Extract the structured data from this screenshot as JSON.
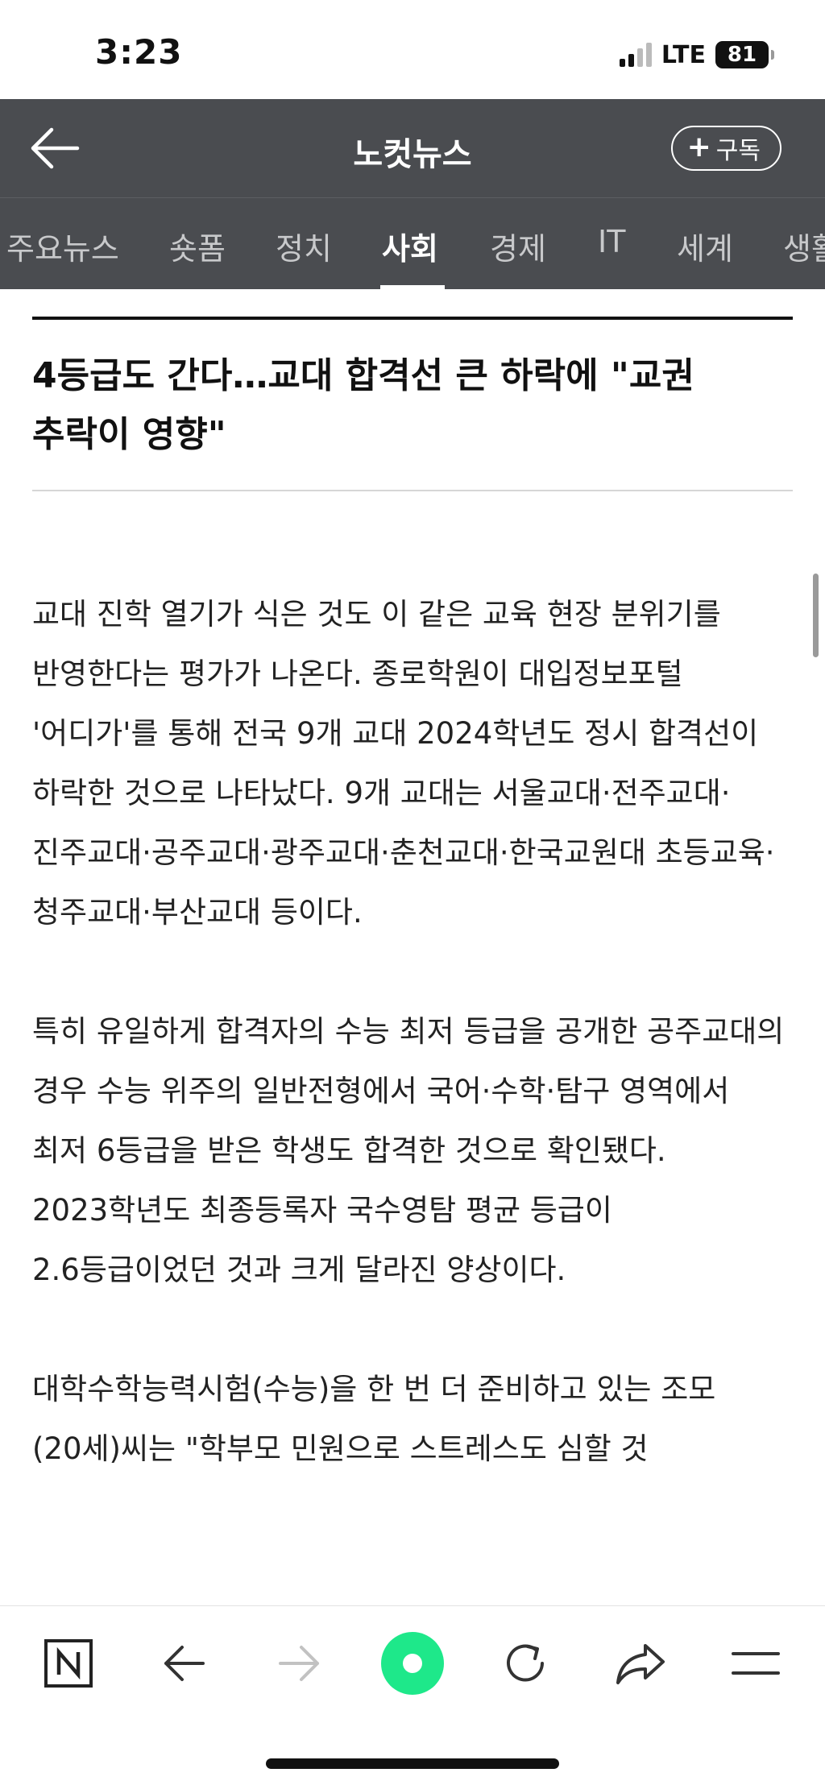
{
  "status_bar": {
    "time": "3:23",
    "network": "LTE",
    "battery": "81"
  },
  "header": {
    "title": "노컷뉴스",
    "subscribe_label": "구독"
  },
  "tabs": [
    {
      "label": "주요뉴스"
    },
    {
      "label": "숏폼"
    },
    {
      "label": "정치"
    },
    {
      "label": "사회",
      "active": true
    },
    {
      "label": "경제"
    },
    {
      "label": "IT"
    },
    {
      "label": "세계"
    },
    {
      "label": "생활"
    }
  ],
  "article": {
    "headline_line1": "4등급도 간다…교대 합격선 큰 하락에 \"교권",
    "headline_line2": "추락이 영향\"",
    "paragraphs": [
      "교대 진학 열기가 식은 것도 이 같은 교육 현장 분위기를 반영한다는 평가가 나온다. 종로학원이 대입정보포털 '어디가'를 통해 전국 9개 교대 2024학년도 정시 합격선이 하락한 것으로 나타났다. 9개 교대는 서울교대·전주교대·진주교대·공주교대·광주교대·춘천교대·한국교원대 초등교육·청주교대·부산교대 등이다.",
      "특히 유일하게 합격자의 수능 최저 등급을 공개한 공주교대의 경우 수능 위주의 일반전형에서 국어·수학·탐구 영역에서 최저 6등급을 받은 학생도 합격한 것으로 확인됐다. 2023학년도 최종등록자 국수영탐 평균 등급이 2.6등급이었던 것과 크게 달라진 양상이다.",
      "대학수학능력시험(수능)을 한 번 더 준비하고 있는 조모(20세)씨는 \"학부모 민원으로 스트레스도 심할 것"
    ]
  },
  "toolbar": {
    "items": [
      "naver-home-icon",
      "back-arrow-icon",
      "forward-arrow-icon",
      "green-dot-icon",
      "refresh-icon",
      "share-icon",
      "menu-icon"
    ]
  },
  "colors": {
    "header_bg": "#4a4c50",
    "green_dot": "#1ee88a",
    "text": "#222222"
  }
}
